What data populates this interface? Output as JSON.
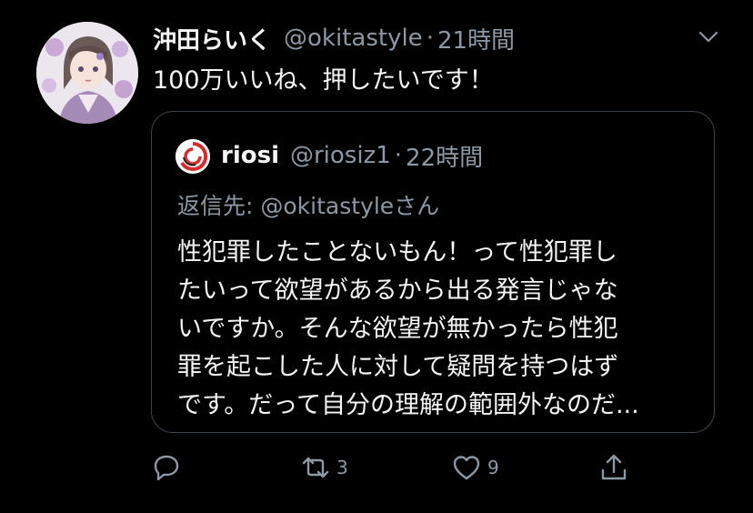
{
  "tweet": {
    "display_name": "沖田らいく",
    "handle": "@okitastyle",
    "separator": "·",
    "time": "21時間",
    "text": "100万いいね、押したいです！"
  },
  "quoted": {
    "display_name": "riosi",
    "handle": "@riosiz1",
    "separator": "·",
    "time": "22時間",
    "reply_prefix": "返信先: ",
    "reply_handle": "@okitastyle",
    "reply_suffix": "さん",
    "lines": [
      "性犯罪したことないもん！って性犯罪し",
      "たいって欲望があるから出る発言じゃな",
      "いですか。そんな欲望が無かったら性犯",
      "罪を起こした人に対して疑問を持つはず",
      "です。だって自分の理解の範囲外なのだ..."
    ]
  },
  "actions": {
    "reply_icon": "reply-icon",
    "retweet_icon": "retweet-icon",
    "retweet_count": "3",
    "like_icon": "heart-icon",
    "like_count": "9",
    "share_icon": "share-icon"
  },
  "colors": {
    "background": "#000000",
    "muted": "#8b98a5",
    "text": "#f5f5f5",
    "border": "#38444d",
    "accent_red": "#d62b2b"
  }
}
